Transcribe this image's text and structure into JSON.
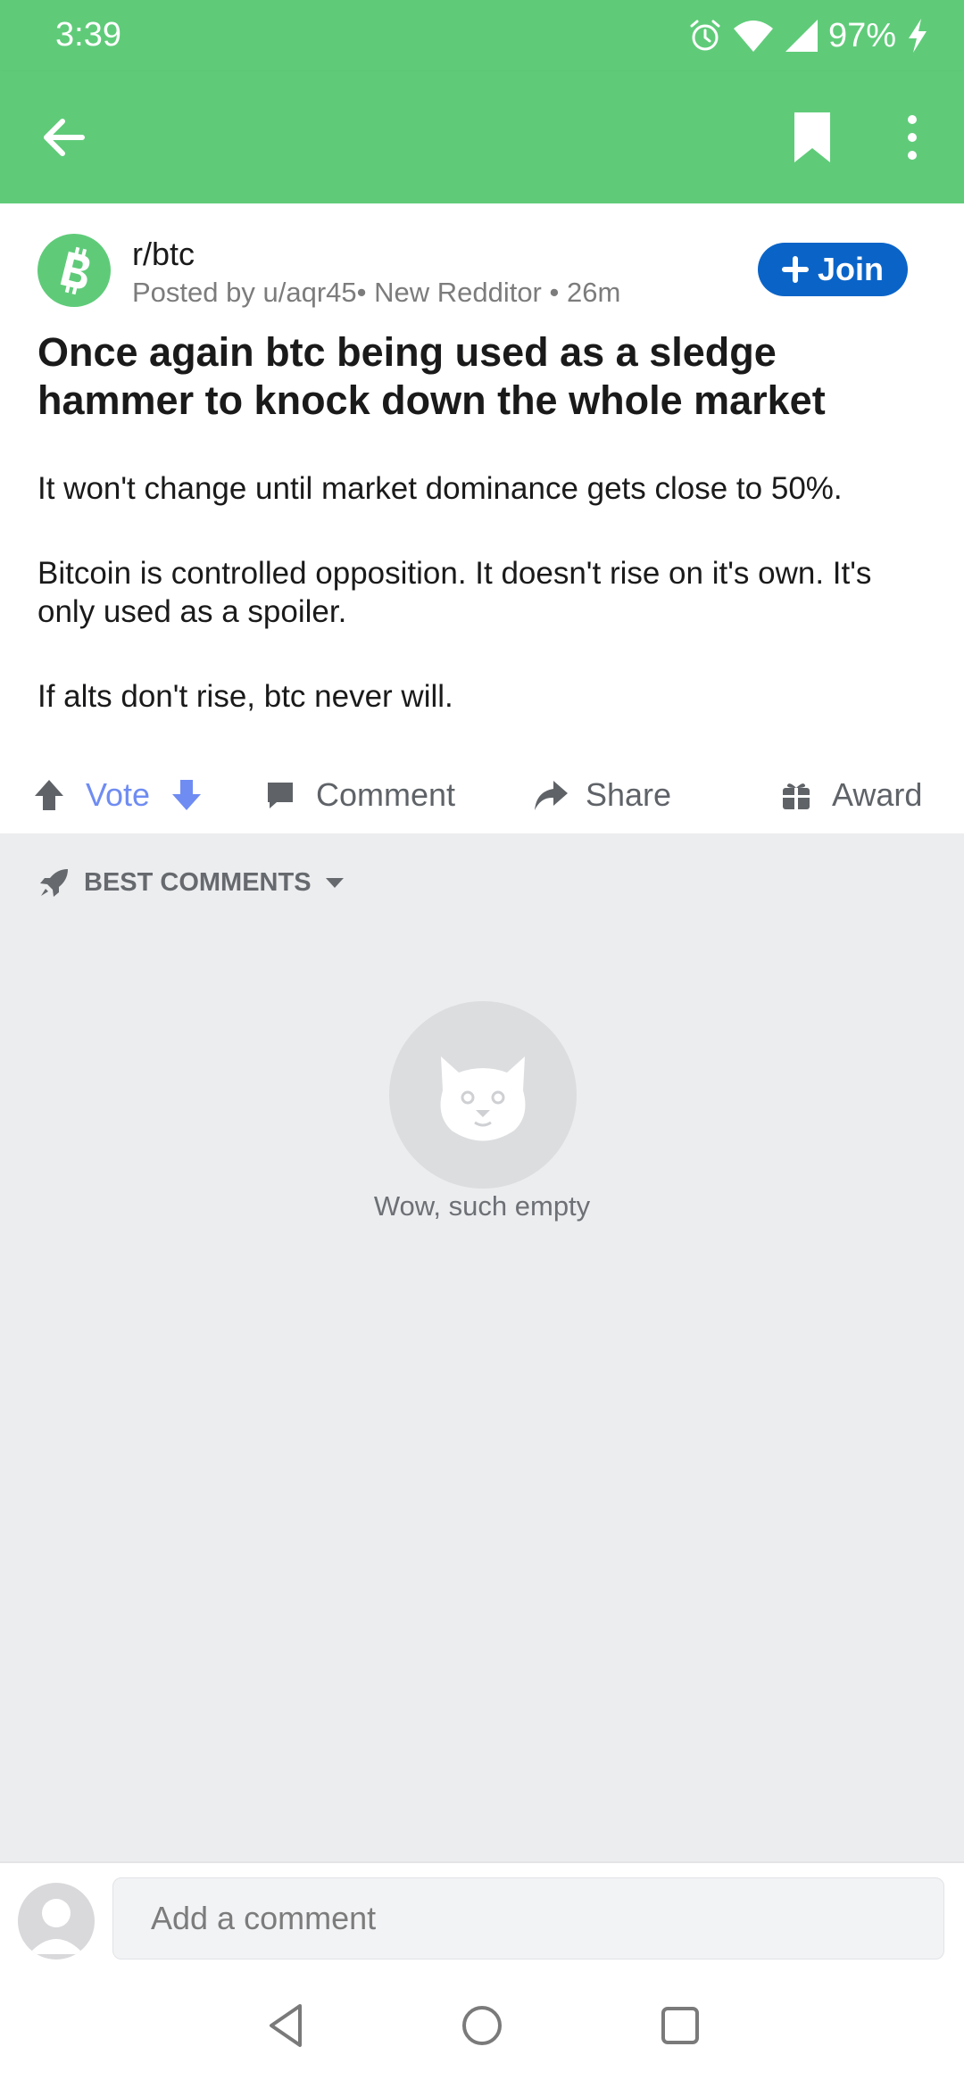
{
  "status_bar": {
    "time": "3:39",
    "battery": "97%"
  },
  "toolbar": {
    "back_icon": "arrow-left-icon",
    "bookmark_icon": "bookmark-icon",
    "more_icon": "more-vertical-icon"
  },
  "post": {
    "subreddit": "r/btc",
    "meta": "Posted by u/aqr45• New Redditor • 26m",
    "join_label": "Join",
    "title": "Once again btc being used as a sledge hammer to knock down the whole market",
    "body": [
      "It won't change until market dominance gets close to 50%.",
      "Bitcoin is controlled opposition.  It doesn't rise on it's own. It's only used as a spoiler.",
      "If alts don't rise, btc never will."
    ]
  },
  "actions": {
    "vote_label": "Vote",
    "comment_label": "Comment",
    "share_label": "Share",
    "award_label": "Award"
  },
  "comments": {
    "sort_label": "BEST COMMENTS",
    "empty_text": "Wow, such empty"
  },
  "comment_bar": {
    "placeholder": "Add a comment"
  },
  "colors": {
    "header_green": "#5fcb79",
    "join_blue": "#0a64c8",
    "vote_blue": "#6f8cf2"
  }
}
